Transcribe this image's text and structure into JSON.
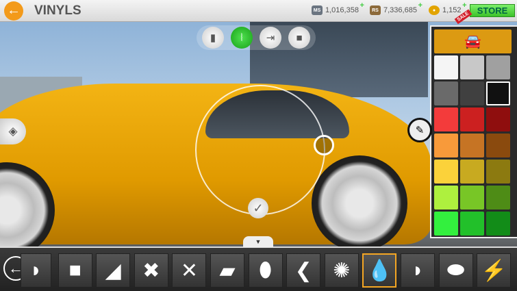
{
  "header": {
    "title": "VINYLS",
    "back_icon": "arrow-left-icon",
    "currencies": [
      {
        "icon": "MS",
        "value": "1,016,358",
        "color": "#6a7480"
      },
      {
        "icon": "RS",
        "value": "7,336,685",
        "color": "#8c6a3a"
      },
      {
        "icon": "gold",
        "value": "1,152",
        "color": "#e2a400"
      }
    ],
    "store_label": "STORE",
    "sale_label": "SALE"
  },
  "tools": [
    {
      "name": "file",
      "glyph": "▮"
    },
    {
      "name": "symmetry",
      "glyph": "⦚",
      "active": true
    },
    {
      "name": "move-layer",
      "glyph": "⇥"
    },
    {
      "name": "camera",
      "glyph": "■"
    }
  ],
  "palette": {
    "car_tile_glyph": "🚗",
    "selected": "#111111",
    "colors": [
      "#f5f5f5",
      "#c8c8c8",
      "#a0a0a0",
      "#6a6a6a",
      "#404040",
      "#111111",
      "#f33b3b",
      "#cc2020",
      "#8f0e0e",
      "#f89a3a",
      "#c67424",
      "#8a4a0e",
      "#fbd23a",
      "#c8aa20",
      "#8c7a10",
      "#aef03e",
      "#78c626",
      "#4e8c16",
      "#33f03e",
      "#22c02a",
      "#128c18"
    ]
  },
  "shapes": [
    {
      "name": "half-hexagon",
      "glyph": "◗"
    },
    {
      "name": "rounded-square",
      "glyph": "■"
    },
    {
      "name": "right-triangle",
      "glyph": "◢"
    },
    {
      "name": "thick-x",
      "glyph": "✖"
    },
    {
      "name": "x",
      "glyph": "✕"
    },
    {
      "name": "parallelogram",
      "glyph": "▰"
    },
    {
      "name": "shield",
      "glyph": "⬮"
    },
    {
      "name": "chevron-left",
      "glyph": "❮"
    },
    {
      "name": "splat",
      "glyph": "✺"
    },
    {
      "name": "drop",
      "glyph": "💧",
      "selected": true
    },
    {
      "name": "half-circle",
      "glyph": "◗"
    },
    {
      "name": "lens",
      "glyph": "⬬"
    },
    {
      "name": "lightning",
      "glyph": "⚡"
    }
  ]
}
